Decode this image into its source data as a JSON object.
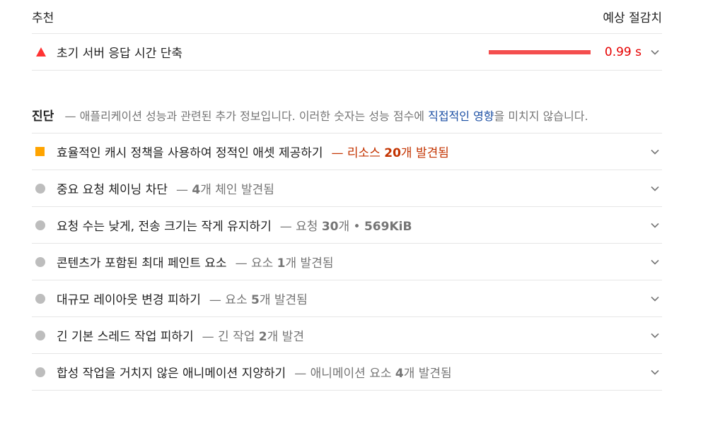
{
  "colors": {
    "fail": "#f33",
    "warn": "#ffa400",
    "neutral": "#bdbdbd",
    "savings_text": "#e60000",
    "savings_bar": "#f44e4e",
    "link": "#1a4ea3",
    "warn_text": "#c33300"
  },
  "opportunities": {
    "header_label": "추천",
    "header_savings": "예상 절감치",
    "items": [
      {
        "icon": "triangle-fail-icon",
        "title": "초기 서버 응답 시간 단축",
        "savings_fraction": 1.0,
        "savings": "0.99 s"
      }
    ]
  },
  "diagnostics": {
    "label": "진단",
    "dash": "—",
    "desc_before": "애플리케이션 성능과 관련된 추가 정보입니다. 이러한 숫자는 성능 점수에 ",
    "desc_link": "직접적인 영향",
    "desc_after": "을 미치지 않습니다.",
    "items": [
      {
        "icon": "square-warn-icon",
        "title": "효율적인 캐시 정책을 사용하여 정적인 애셋 제공하기",
        "display_prefix": "— 리소스 ",
        "display_num": "20",
        "display_suffix": "개 발견됨",
        "warn": true
      },
      {
        "icon": "circle-info-icon",
        "title": "중요 요청 체이닝 차단",
        "display_prefix": "— ",
        "display_num": "4",
        "display_suffix": "개 체인 발견됨",
        "warn": false
      },
      {
        "icon": "circle-info-icon",
        "title": "요청 수는 낮게, 전송 크기는 작게 유지하기",
        "display_prefix": "— 요청 ",
        "display_num": "30",
        "display_suffix": "개 • ",
        "display_num2": "569KiB",
        "warn": false
      },
      {
        "icon": "circle-info-icon",
        "title": "콘텐츠가 포함된 최대 페인트 요소",
        "display_prefix": "— 요소 ",
        "display_num": "1",
        "display_suffix": "개 발견됨",
        "warn": false
      },
      {
        "icon": "circle-info-icon",
        "title": "대규모 레이아웃 변경 피하기",
        "display_prefix": "— 요소 ",
        "display_num": "5",
        "display_suffix": "개 발견됨",
        "warn": false
      },
      {
        "icon": "circle-info-icon",
        "title": "긴 기본 스레드 작업 피하기",
        "display_prefix": "— 긴 작업 ",
        "display_num": "2",
        "display_suffix": "개 발견",
        "warn": false
      },
      {
        "icon": "circle-info-icon",
        "title": "합성 작업을 거치지 않은 애니메이션 지양하기",
        "display_prefix": "— 애니메이션 요소 ",
        "display_num": "4",
        "display_suffix": "개 발견됨",
        "warn": false
      }
    ]
  }
}
